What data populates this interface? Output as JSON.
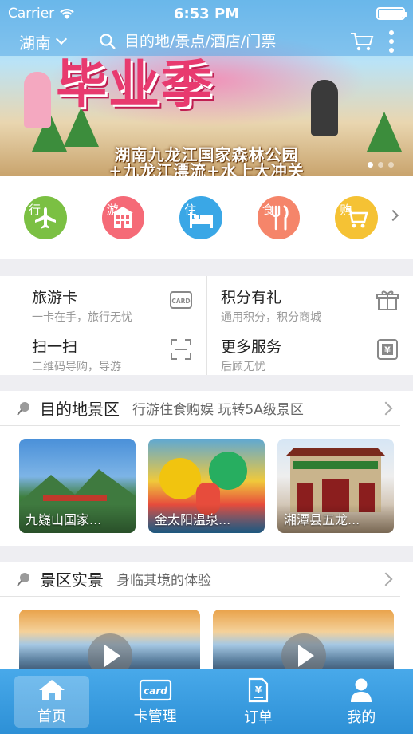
{
  "status_bar": {
    "carrier": "Carrier",
    "time": "6:53 PM"
  },
  "header": {
    "city": "湖南",
    "search_placeholder": "目的地/景点/酒店/门票"
  },
  "banner": {
    "headline": "毕业季",
    "caption_line1": "湖南九龙江国家森林公园",
    "caption_line2": "+九龙江漂流+水上大冲关"
  },
  "categories": [
    {
      "label": "行",
      "icon": "airplane-icon",
      "color": "#7bc043"
    },
    {
      "label": "游",
      "icon": "building-icon",
      "color": "#f56a77"
    },
    {
      "label": "住",
      "icon": "bed-icon",
      "color": "#3aa7e6"
    },
    {
      "label": "食",
      "icon": "fork-knife-icon",
      "color": "#f5856a"
    },
    {
      "label": "购",
      "icon": "shopping-cart-icon",
      "color": "#f5c234"
    }
  ],
  "services": [
    {
      "title": "旅游卡",
      "subtitle": "一卡在手，旅行无忧",
      "icon": "card-icon",
      "icon_text": "CARD"
    },
    {
      "title": "积分有礼",
      "subtitle": "通用积分，积分商城",
      "icon": "gift-icon"
    },
    {
      "title": "扫一扫",
      "subtitle": "二维码导购，导游",
      "icon": "scan-icon"
    },
    {
      "title": "更多服务",
      "subtitle": "后顾无忧",
      "icon": "yen-icon",
      "icon_text": "¥"
    }
  ],
  "destinations": {
    "title": "目的地景区",
    "subtitle": "行游住食购娱 玩转5A级景区",
    "items": [
      {
        "name": "九嶷山国家..."
      },
      {
        "name": "金太阳温泉..."
      },
      {
        "name": "湘潭县五龙..."
      }
    ]
  },
  "scenery": {
    "title": "景区实景",
    "subtitle": "身临其境的体验"
  },
  "tabs": [
    {
      "label": "首页",
      "icon": "home-icon",
      "active": true
    },
    {
      "label": "卡管理",
      "icon": "card-manage-icon",
      "icon_text": "card",
      "active": false
    },
    {
      "label": "订单",
      "icon": "order-icon",
      "icon_text": "¥",
      "active": false
    },
    {
      "label": "我的",
      "icon": "user-icon",
      "active": false
    }
  ]
}
